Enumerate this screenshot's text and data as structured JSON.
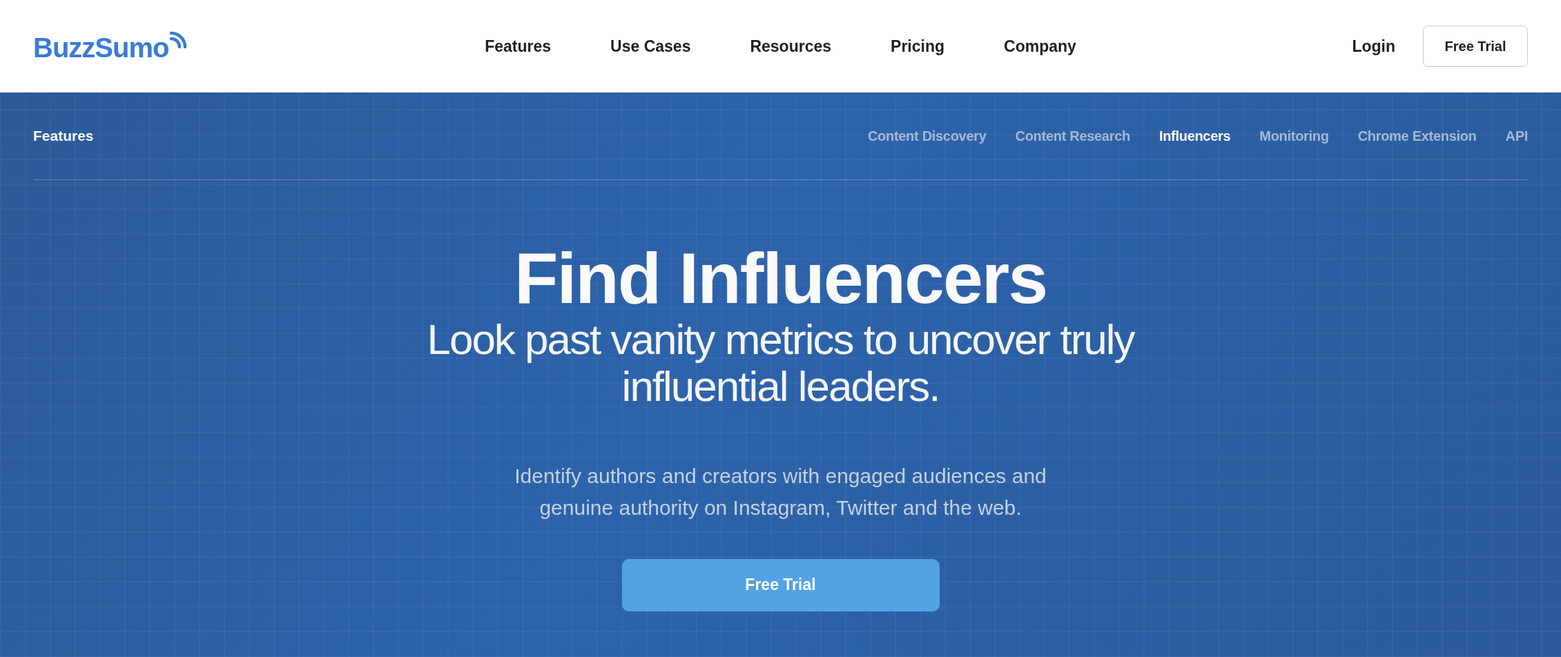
{
  "header": {
    "logo": "BuzzSumo",
    "nav": [
      "Features",
      "Use Cases",
      "Resources",
      "Pricing",
      "Company"
    ],
    "login": "Login",
    "trial_button": "Free Trial"
  },
  "subnav": {
    "title": "Features",
    "items": [
      {
        "label": "Content Discovery",
        "selected": false
      },
      {
        "label": "Content Research",
        "selected": false
      },
      {
        "label": "Influencers",
        "selected": true
      },
      {
        "label": "Monitoring",
        "selected": false
      },
      {
        "label": "Chrome Extension",
        "selected": false
      },
      {
        "label": "API",
        "selected": false
      }
    ]
  },
  "hero": {
    "title": "Find Influencers",
    "subtitle": "Look past vanity metrics to uncover truly influential leaders.",
    "description": "Identify authors and creators with engaged audiences and genuine authority on Instagram, Twitter and the web.",
    "button": "Free Trial"
  }
}
